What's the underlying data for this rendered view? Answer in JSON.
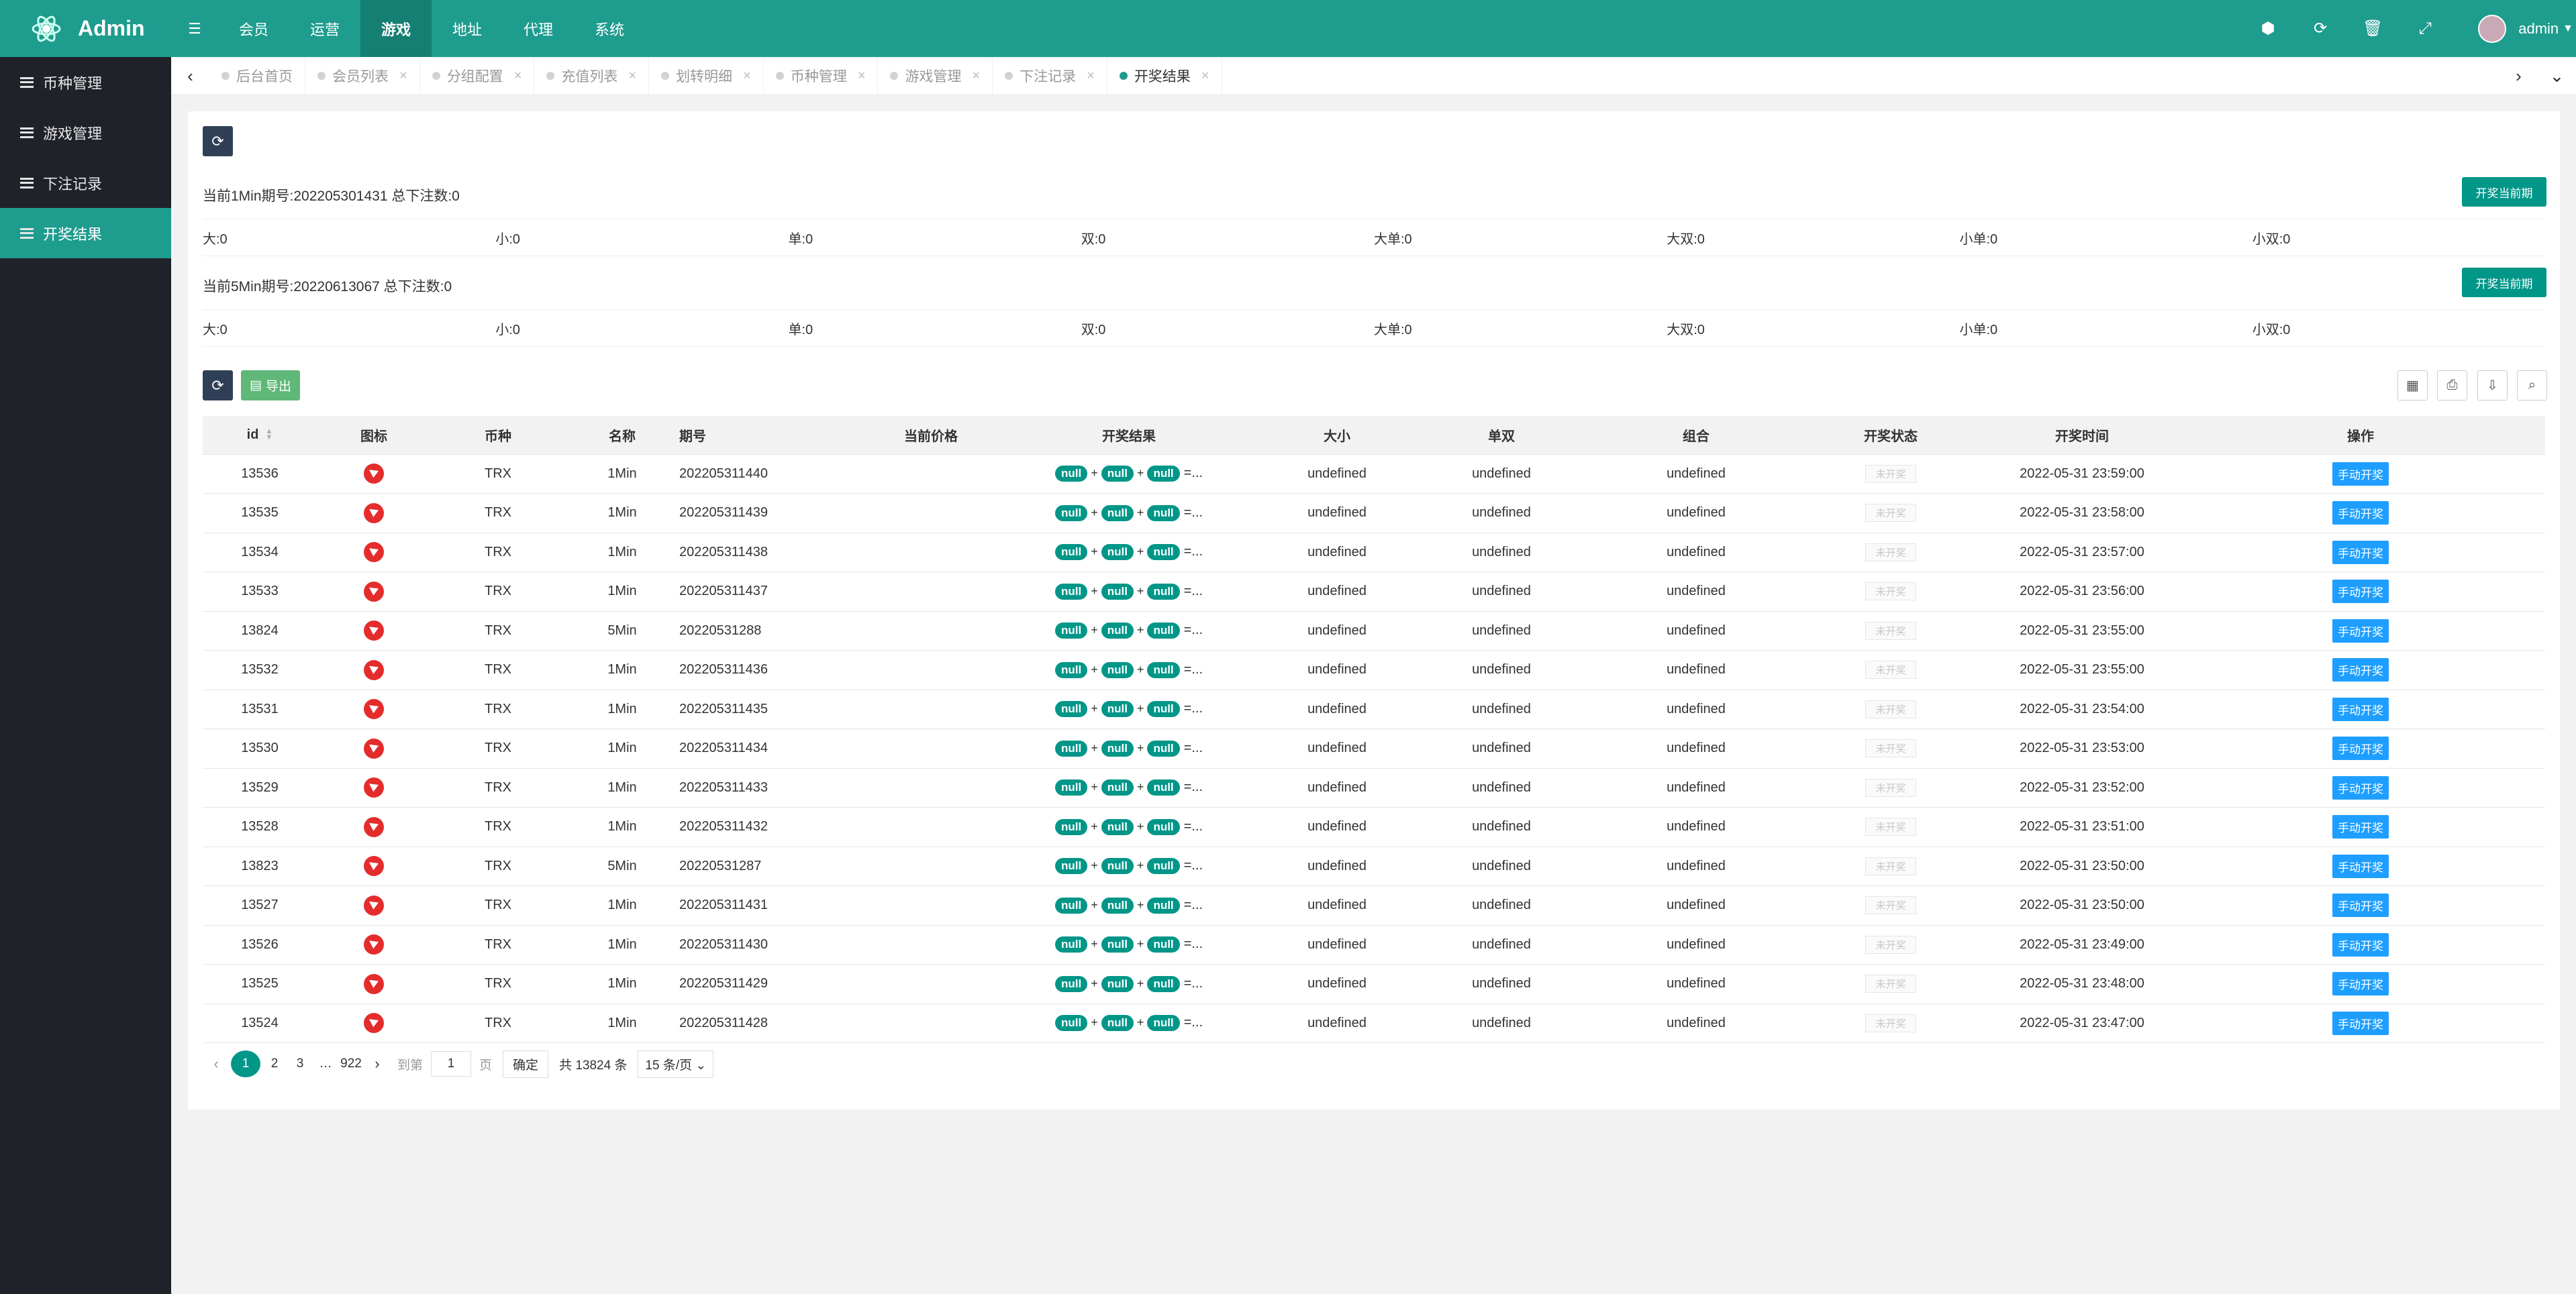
{
  "app": {
    "title": "Admin",
    "user": "admin"
  },
  "sidebar": {
    "items": [
      {
        "label": "币种管理"
      },
      {
        "label": "游戏管理"
      },
      {
        "label": "下注记录"
      },
      {
        "label": "开奖结果"
      }
    ]
  },
  "header": {
    "nav": [
      "会员",
      "运营",
      "游戏",
      "地址",
      "代理",
      "系统"
    ],
    "active": "游戏"
  },
  "tabs": [
    "后台首页",
    "会员列表",
    "分组配置",
    "充值列表",
    "划转明细",
    "币种管理",
    "游戏管理",
    "下注记录",
    "开奖结果"
  ],
  "period1": {
    "text": "当前1Min期号:202205301431 总下注数:0",
    "button": "开奖当前期"
  },
  "period5": {
    "text": "当前5Min期号:20220613067 总下注数:0",
    "button": "开奖当前期"
  },
  "bets": [
    "大:0",
    "小:0",
    "单:0",
    "双:0",
    "大单:0",
    "大双:0",
    "小单:0",
    "小双:0"
  ],
  "toolbar": {
    "export": "导出"
  },
  "table": {
    "headers": [
      "id",
      "图标",
      "币种",
      "名称",
      "期号",
      "当前价格",
      "开奖结果",
      "大小",
      "单双",
      "组合",
      "开奖状态",
      "开奖时间",
      "操作"
    ],
    "rows": [
      {
        "id": "13536",
        "coin": "TRX",
        "name": "1Min",
        "issue": "202205311440",
        "time": "2022-05-31 23:59:00"
      },
      {
        "id": "13535",
        "coin": "TRX",
        "name": "1Min",
        "issue": "202205311439",
        "time": "2022-05-31 23:58:00"
      },
      {
        "id": "13534",
        "coin": "TRX",
        "name": "1Min",
        "issue": "202205311438",
        "time": "2022-05-31 23:57:00"
      },
      {
        "id": "13533",
        "coin": "TRX",
        "name": "1Min",
        "issue": "202205311437",
        "time": "2022-05-31 23:56:00"
      },
      {
        "id": "13824",
        "coin": "TRX",
        "name": "5Min",
        "issue": "20220531288",
        "time": "2022-05-31 23:55:00"
      },
      {
        "id": "13532",
        "coin": "TRX",
        "name": "1Min",
        "issue": "202205311436",
        "time": "2022-05-31 23:55:00"
      },
      {
        "id": "13531",
        "coin": "TRX",
        "name": "1Min",
        "issue": "202205311435",
        "time": "2022-05-31 23:54:00"
      },
      {
        "id": "13530",
        "coin": "TRX",
        "name": "1Min",
        "issue": "202205311434",
        "time": "2022-05-31 23:53:00"
      },
      {
        "id": "13529",
        "coin": "TRX",
        "name": "1Min",
        "issue": "202205311433",
        "time": "2022-05-31 23:52:00"
      },
      {
        "id": "13528",
        "coin": "TRX",
        "name": "1Min",
        "issue": "202205311432",
        "time": "2022-05-31 23:51:00"
      },
      {
        "id": "13823",
        "coin": "TRX",
        "name": "5Min",
        "issue": "20220531287",
        "time": "2022-05-31 23:50:00"
      },
      {
        "id": "13527",
        "coin": "TRX",
        "name": "1Min",
        "issue": "202205311431",
        "time": "2022-05-31 23:50:00"
      },
      {
        "id": "13526",
        "coin": "TRX",
        "name": "1Min",
        "issue": "202205311430",
        "time": "2022-05-31 23:49:00"
      },
      {
        "id": "13525",
        "coin": "TRX",
        "name": "1Min",
        "issue": "202205311429",
        "time": "2022-05-31 23:48:00"
      },
      {
        "id": "13524",
        "coin": "TRX",
        "name": "1Min",
        "issue": "202205311428",
        "time": "2022-05-31 23:47:00"
      }
    ],
    "result_pill": "null",
    "result_tail": "=...",
    "undefined_text": "undefined",
    "status_text": "未开奖",
    "action_text": "手动开奖"
  },
  "pagination": {
    "pages": [
      "1",
      "2",
      "3"
    ],
    "ellipsis": "…",
    "last": "922",
    "goto": "到第",
    "jump_value": "1",
    "page_unit": "页",
    "confirm": "确定",
    "total": "共 13824 条",
    "per_page": "15 条/页"
  }
}
